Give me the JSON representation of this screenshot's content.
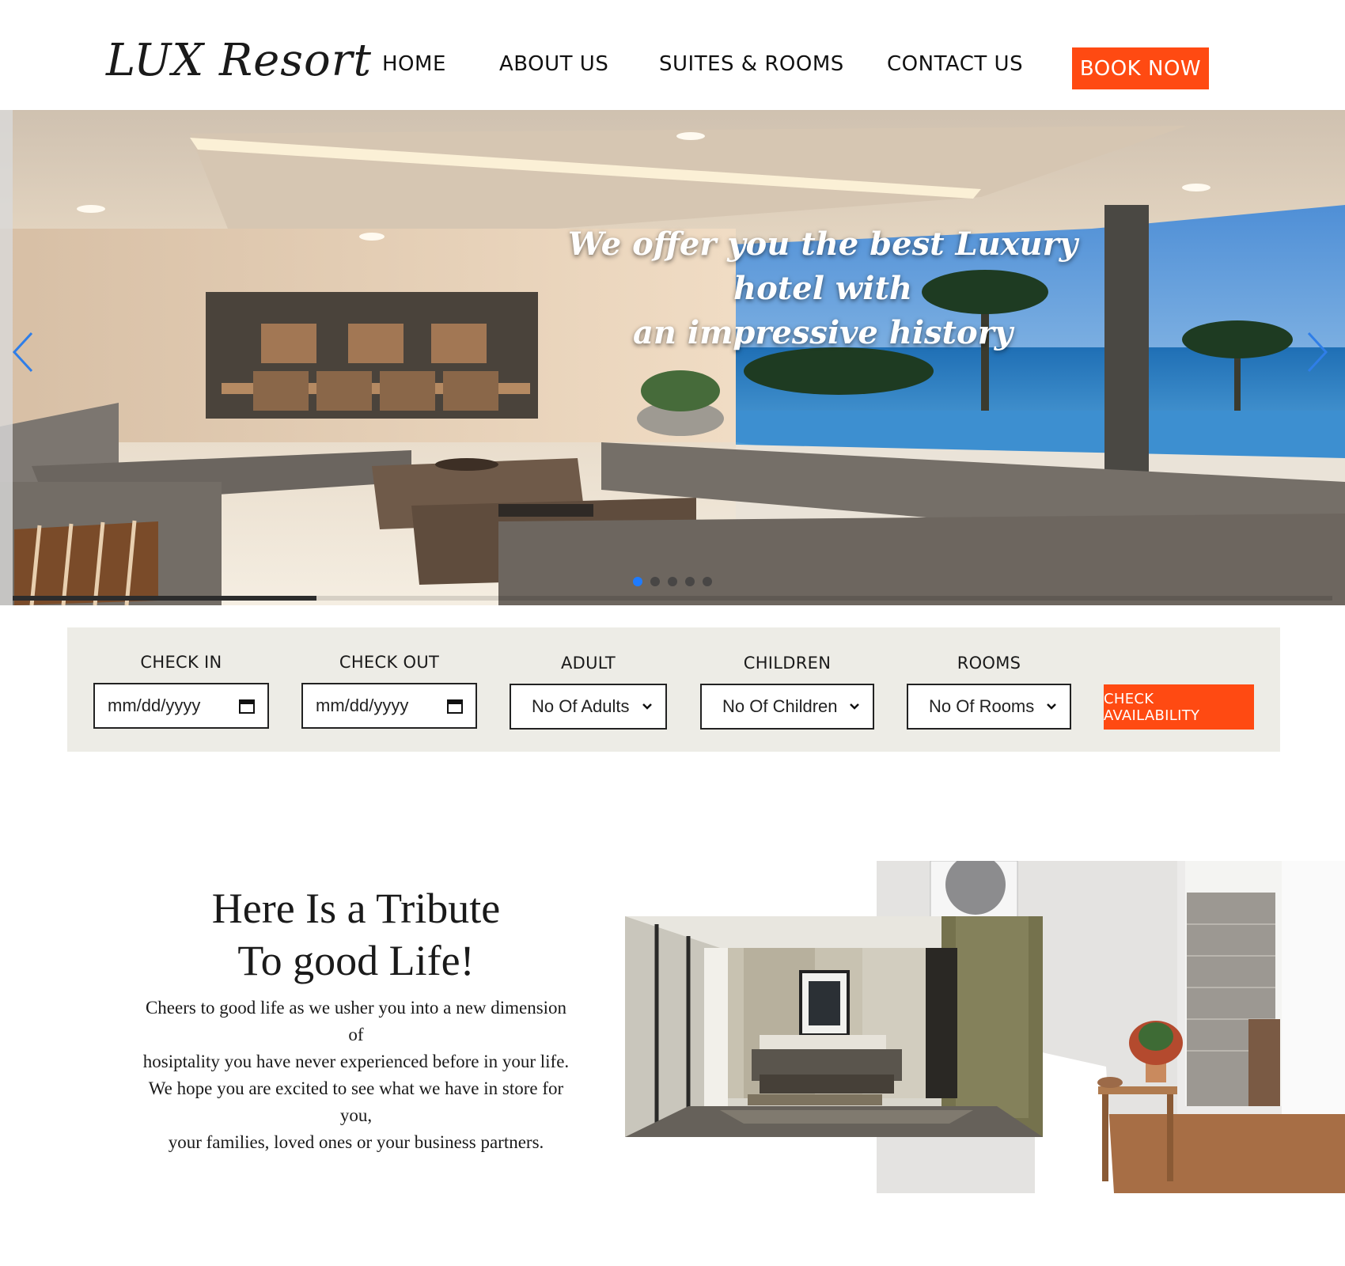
{
  "header": {
    "logo": "LUX Resort",
    "nav": [
      "HOME",
      "ABOUT US",
      "SUITES & ROOMS",
      "CONTACT US"
    ],
    "book_now": "BOOK NOW"
  },
  "hero": {
    "caption_line1": "We offer you the best Luxury hotel with",
    "caption_line2": "an impressive history",
    "slide_count": 5,
    "active_slide": 1,
    "progress": 0.23
  },
  "booking": {
    "check_in": {
      "label": "CHECK IN",
      "placeholder": "mm/dd/yyyy"
    },
    "check_out": {
      "label": "CHECK OUT",
      "placeholder": "mm/dd/yyyy"
    },
    "adult": {
      "label": "ADULT",
      "selected": "No Of Adults"
    },
    "children": {
      "label": "CHILDREN",
      "selected": "No Of Children"
    },
    "rooms": {
      "label": "ROOMS",
      "selected": "No Of Rooms"
    },
    "button": "CHECK AVAILABILITY"
  },
  "tribute": {
    "title_line1": "Here Is a Tribute",
    "title_line2": "To good Life!",
    "lines": [
      "Cheers to good life as we usher you into a new dimension",
      "of",
      "hosiptality you have never experienced before in your life.",
      "We hope you are excited to see what we have in store for",
      "you,",
      "your families, loved ones or your business partners."
    ]
  },
  "colors": {
    "accent": "#ff4a12",
    "booking_bg": "#edece6",
    "active_dot": "#1e7bff"
  }
}
